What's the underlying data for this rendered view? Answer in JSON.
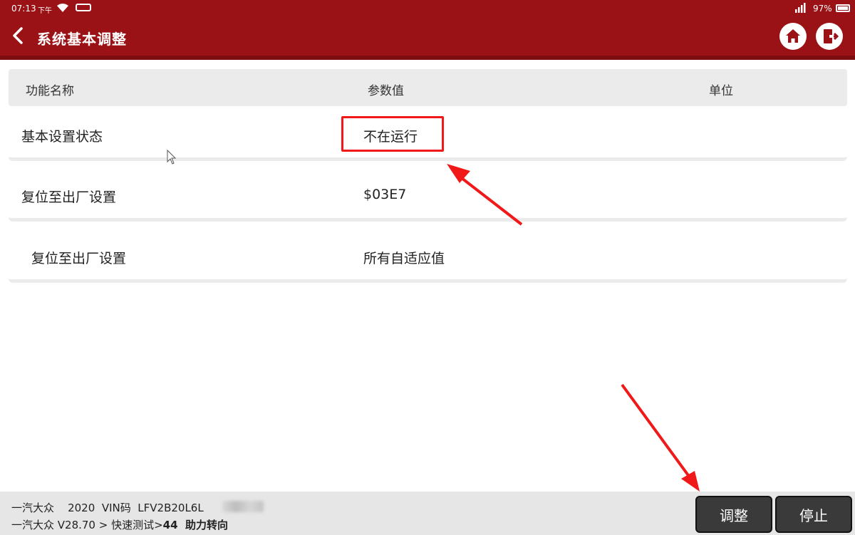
{
  "status_bar": {
    "time": "07:13",
    "ampm": "下午",
    "battery": "97%"
  },
  "header": {
    "title": "系统基本调整",
    "back_icon": "chevron-left-icon",
    "home_icon": "home-icon",
    "exit_icon": "exit-icon"
  },
  "table": {
    "headers": [
      "功能名称",
      "参数值",
      "单位"
    ],
    "rows": [
      {
        "name": "基本设置状态",
        "value": "不在运行",
        "unit": ""
      },
      {
        "name": "复位至出厂设置",
        "value": "$03E7",
        "unit": ""
      },
      {
        "name": "复位至出厂设置",
        "value": "所有自适应值",
        "unit": ""
      }
    ]
  },
  "footer": {
    "make": "一汽大众",
    "year": "2020",
    "vin_label": "VIN码",
    "vin_visible": "LFV2B20L6L",
    "path_prefix": "一汽大众 V28.70 > 快速测试>",
    "path_current": "44  助力转向",
    "adjust_label": "调整",
    "stop_label": "停止"
  },
  "colors": {
    "header": "#9a1215",
    "annotation": "#f01818",
    "button": "#3a3a3a"
  }
}
